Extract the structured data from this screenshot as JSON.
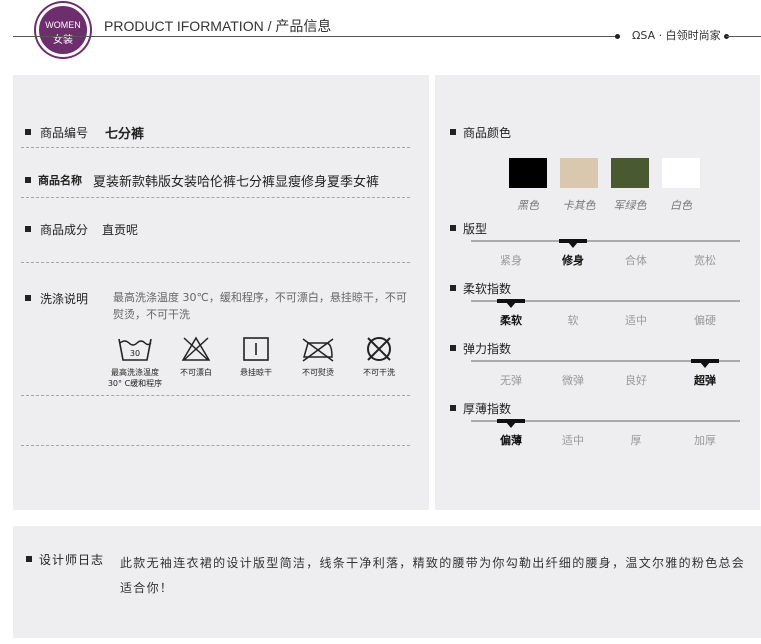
{
  "header": {
    "badge_top": "WOMEN",
    "badge_bottom": "女装",
    "title": "PRODUCT IFORMATION / 产品信息",
    "brand": "ΩSA · 白领时尚家"
  },
  "left": {
    "product_code": {
      "label": "商品编号",
      "value": "七分裤"
    },
    "product_name": {
      "label": "商品名称",
      "value": "夏装新款韩版女装哈伦裤七分裤显瘦修身夏季女裤"
    },
    "material": {
      "label": "商品成分",
      "value": "直贡呢"
    },
    "washing": {
      "label": "洗涤说明",
      "desc": "最高洗涤温度 30℃，缓和程序，不可漂白，悬挂晾干，不可熨烫，不可干洗",
      "icons": [
        {
          "name": "wash-30-icon",
          "caption": "最高洗涤温度\n30° C缓和程序",
          "tub_number": "30"
        },
        {
          "name": "no-bleach-icon",
          "caption": "不可漂白"
        },
        {
          "name": "hang-dry-icon",
          "caption": "悬挂晾干"
        },
        {
          "name": "no-iron-icon",
          "caption": "不可熨烫"
        },
        {
          "name": "no-dry-clean-icon",
          "caption": "不可干洗"
        }
      ]
    }
  },
  "right": {
    "colors": {
      "label": "商品颜色",
      "items": [
        {
          "name": "黑色",
          "hex": "#000000"
        },
        {
          "name": "卡其色",
          "hex": "#d9c8ae"
        },
        {
          "name": "军绿色",
          "hex": "#4a5a30"
        },
        {
          "name": "白色",
          "hex": "#ffffff"
        }
      ]
    },
    "scales": [
      {
        "label": "版型",
        "options": [
          "紧身",
          "修身",
          "合体",
          "宽松"
        ],
        "selected": 1
      },
      {
        "label": "柔软指数",
        "options": [
          "柔软",
          "软",
          "适中",
          "偏硬"
        ],
        "selected": 0
      },
      {
        "label": "弹力指数",
        "options": [
          "无弹",
          "微弹",
          "良好",
          "超弹"
        ],
        "selected": 3
      },
      {
        "label": "厚薄指数",
        "options": [
          "偏薄",
          "适中",
          "厚",
          "加厚"
        ],
        "selected": 0
      }
    ]
  },
  "designer": {
    "label": "设计师日志",
    "text": "此款无袖连衣裙的设计版型简洁，线条干净利落，精致的腰带为你勾勒出纤细的腰身，温文尔雅的粉色总会适合你！"
  }
}
